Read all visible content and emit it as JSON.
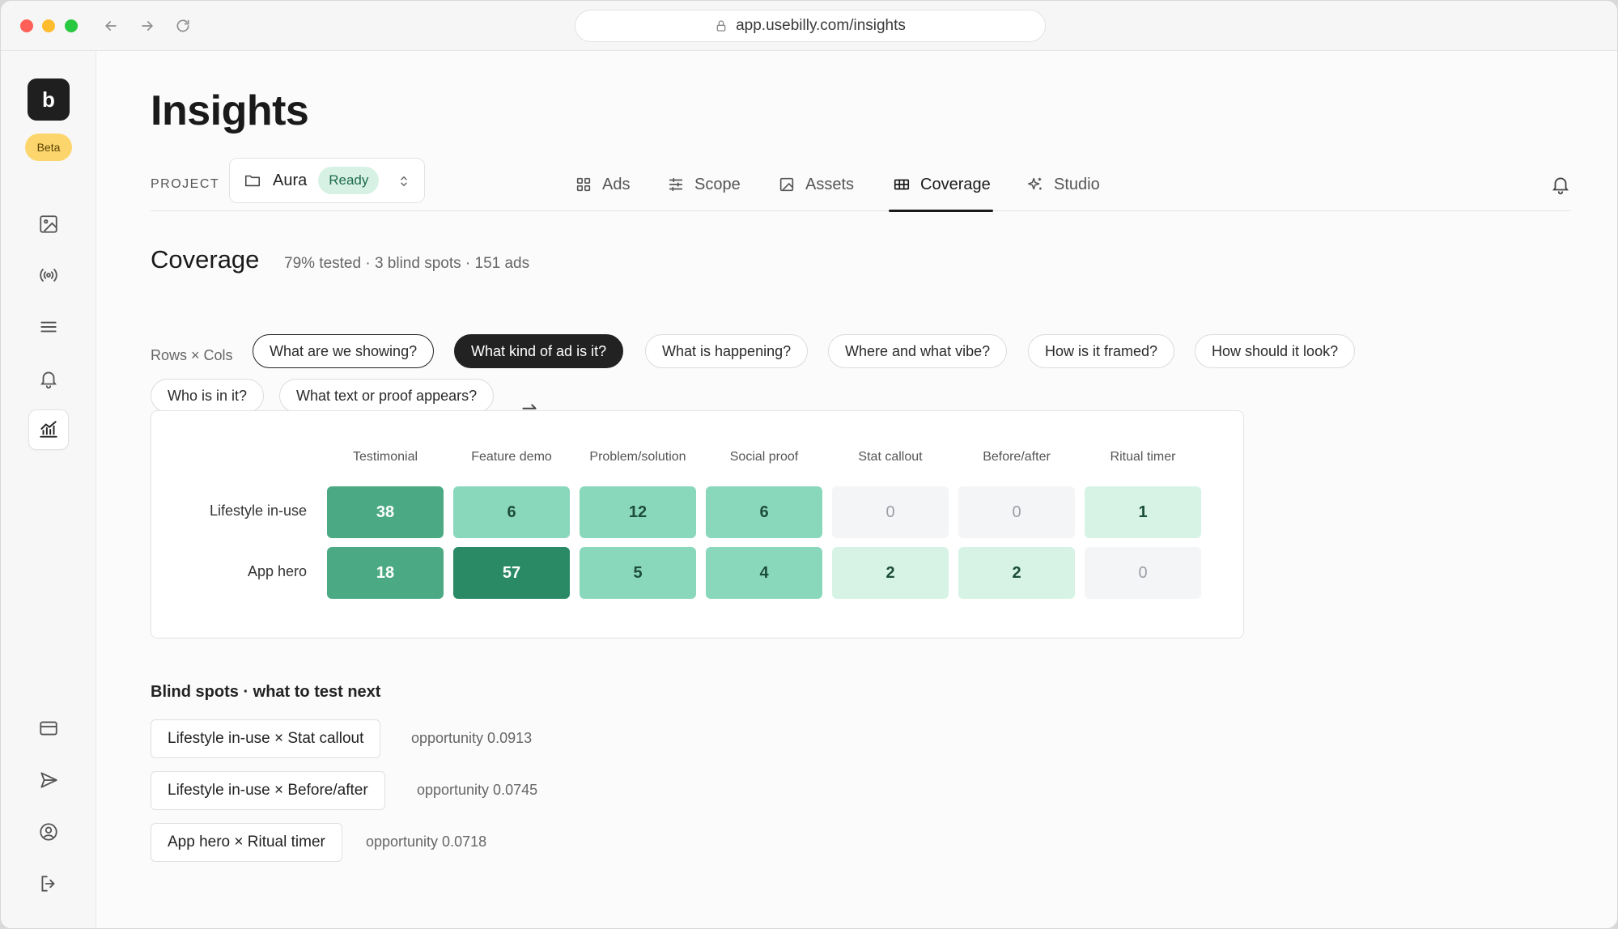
{
  "browser": {
    "url": "app.usebilly.com/insights"
  },
  "sidebar": {
    "logo": "b",
    "badge": "Beta",
    "icons": [
      "image-icon",
      "broadcast-icon",
      "menu-icon",
      "bell-icon",
      "chart-icon",
      "card-icon",
      "send-icon",
      "user-circle-icon",
      "logout-icon"
    ]
  },
  "page": {
    "title": "Insights"
  },
  "project": {
    "label": "PROJECT",
    "name": "Aura",
    "status": "Ready"
  },
  "tabs": [
    {
      "label": "Ads",
      "icon": "grid-icon"
    },
    {
      "label": "Scope",
      "icon": "sliders-icon"
    },
    {
      "label": "Assets",
      "icon": "image-icon"
    },
    {
      "label": "Coverage",
      "icon": "table-icon",
      "active": true
    },
    {
      "label": "Studio",
      "icon": "sparkle-icon"
    }
  ],
  "coverage": {
    "title": "Coverage",
    "summary": "79% tested · 3 blind spots · 151 ads"
  },
  "filters": {
    "label": "Rows × Cols",
    "chips": [
      {
        "label": "What are we showing?",
        "state": "row"
      },
      {
        "label": "What kind of ad is it?",
        "state": "col"
      },
      {
        "label": "What is happening?",
        "state": "none"
      },
      {
        "label": "Where and what vibe?",
        "state": "none"
      },
      {
        "label": "How is it framed?",
        "state": "none"
      },
      {
        "label": "How should it look?",
        "state": "none"
      },
      {
        "label": "Who is in it?",
        "state": "none"
      },
      {
        "label": "What text or proof appears?",
        "state": "none"
      }
    ]
  },
  "chart_data": {
    "type": "heatmap",
    "x": [
      "Testimonial",
      "Feature demo",
      "Problem/solution",
      "Social proof",
      "Stat callout",
      "Before/after",
      "Ritual timer"
    ],
    "y": [
      "Lifestyle in-use",
      "App hero"
    ],
    "values": [
      [
        38,
        6,
        12,
        6,
        0,
        0,
        1
      ],
      [
        18,
        57,
        5,
        4,
        2,
        2,
        0
      ]
    ],
    "colors": {
      "darkest": "#2a8a66",
      "dark": "#4baa84",
      "mid": "#8ad8bc",
      "light": "#d6f3e6",
      "empty": "#f4f5f7"
    }
  },
  "blind_spots": {
    "title": "Blind spots · what to test next",
    "items": [
      {
        "label": "Lifestyle in-use × Stat callout",
        "opportunity": "opportunity 0.0913"
      },
      {
        "label": "Lifestyle in-use × Before/after",
        "opportunity": "opportunity 0.0745"
      },
      {
        "label": "App hero × Ritual timer",
        "opportunity": "opportunity 0.0718"
      }
    ]
  }
}
